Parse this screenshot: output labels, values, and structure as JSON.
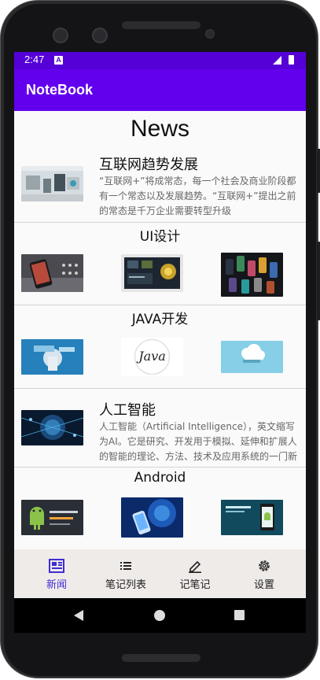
{
  "status_bar": {
    "time": "2:47",
    "notification_letter": "A"
  },
  "app_bar": {
    "title": "NoteBook"
  },
  "page": {
    "title": "News"
  },
  "articles": [
    {
      "title": "互联网趋势发展",
      "body": "“互联网+”将成常态，每一个社会及商业阶段都有一个常态以及发展趋势。“互联网+”提出之前的常态是千万企业需要转型升级"
    },
    {
      "title": "人工智能",
      "body": "人工智能（Artificial Intelligence），英文缩写为AI。它是研究、开发用于模拟、延伸和扩展人的智能的理论、方法、技术及应用系统的一门新的技术科学"
    }
  ],
  "sections": [
    {
      "title": "UI设计"
    },
    {
      "title": "JAVA开发",
      "java_logo_text": "Java"
    },
    {
      "title": "Android"
    }
  ],
  "bottom_nav": {
    "items": [
      {
        "label": "新闻",
        "icon": "news-icon",
        "active": true
      },
      {
        "label": "笔记列表",
        "icon": "list-icon",
        "active": false
      },
      {
        "label": "记笔记",
        "icon": "pencil-icon",
        "active": false
      },
      {
        "label": "设置",
        "icon": "gear-icon",
        "active": false
      }
    ]
  },
  "colors": {
    "status_bar": "#5500d6",
    "app_bar": "#6200ee",
    "nav_active": "#3f2cd6",
    "bottom_nav_bg": "#efebe9"
  }
}
